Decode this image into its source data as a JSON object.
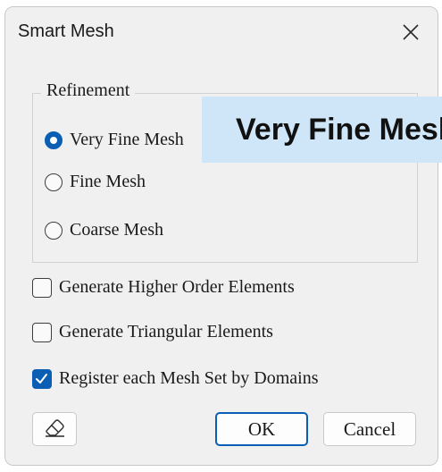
{
  "window": {
    "title": "Smart Mesh",
    "close_icon": "close-icon"
  },
  "refinement": {
    "label": "Refinement",
    "options": [
      {
        "label": "Very Fine Mesh",
        "selected": true
      },
      {
        "label": "Fine Mesh",
        "selected": false
      },
      {
        "label": "Coarse Mesh",
        "selected": false
      }
    ]
  },
  "options": [
    {
      "label": "Generate Higher Order Elements",
      "checked": false
    },
    {
      "label": "Generate Triangular Elements",
      "checked": false
    },
    {
      "label": "Register each Mesh Set by Domains",
      "checked": true
    }
  ],
  "overlay": {
    "text": "Very Fine Mesh"
  },
  "buttons": {
    "ok": "OK",
    "cancel": "Cancel",
    "reset_icon": "eraser-icon"
  },
  "colors": {
    "accent": "#0a5fb4",
    "banner_bg": "#cfe6f8",
    "dialog_bg": "#f0f0f0"
  }
}
